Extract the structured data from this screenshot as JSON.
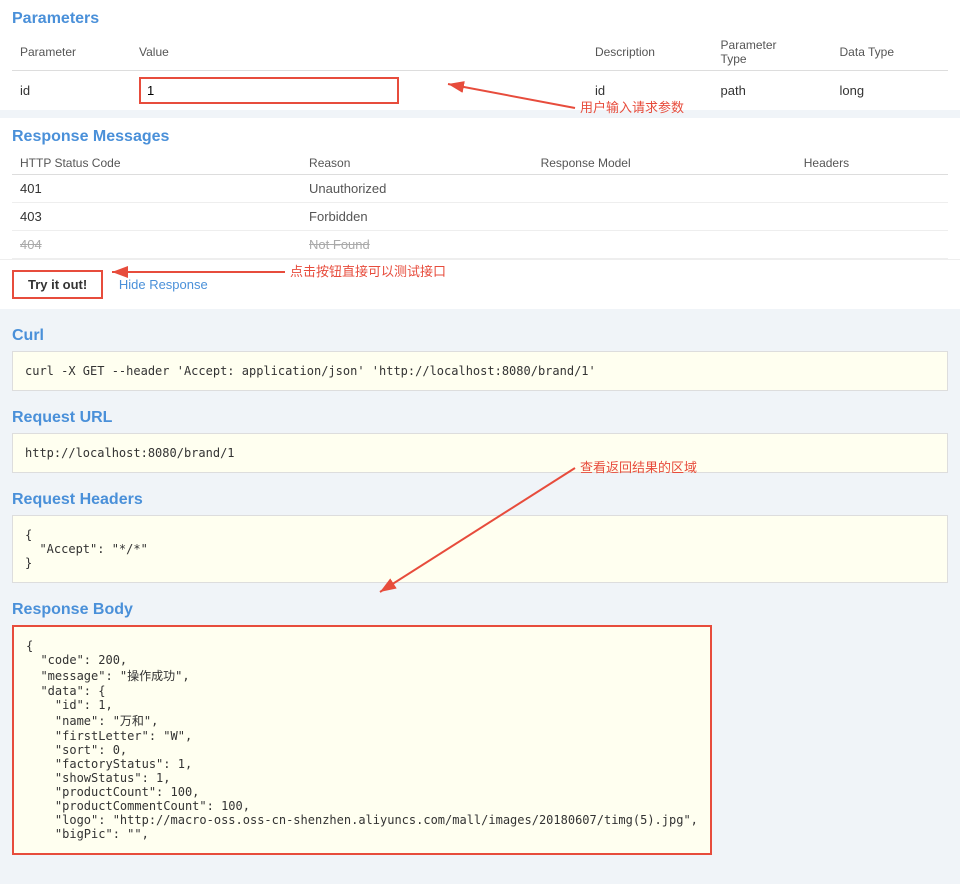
{
  "parameters": {
    "title": "Parameters",
    "columns": {
      "parameter": "Parameter",
      "value": "Value",
      "description": "Description",
      "parameterType": "Parameter Type",
      "dataType": "Data Type"
    },
    "rows": [
      {
        "parameter": "id",
        "value": "1",
        "description": "id",
        "parameterType": "path",
        "dataType": "long"
      }
    ]
  },
  "annotations": {
    "inputHint": "用户输入请求参数",
    "buttonHint": "点击按钮直接可以测试接口",
    "resultHint": "查看返回结果的区域"
  },
  "responseMessages": {
    "title": "Response Messages",
    "columns": {
      "statusCode": "HTTP Status Code",
      "reason": "Reason",
      "responseModel": "Response Model",
      "headers": "Headers"
    },
    "rows": [
      {
        "statusCode": "401",
        "reason": "Unauthorized",
        "responseModel": "",
        "headers": "",
        "strikethrough": false
      },
      {
        "statusCode": "403",
        "reason": "Forbidden",
        "responseModel": "",
        "headers": "",
        "strikethrough": false
      },
      {
        "statusCode": "404",
        "reason": "Not Found",
        "responseModel": "",
        "headers": "",
        "strikethrough": true
      }
    ]
  },
  "buttons": {
    "tryItOut": "Try it out!",
    "hideResponse": "Hide Response"
  },
  "curl": {
    "title": "Curl",
    "value": "curl -X GET --header 'Accept: application/json' 'http://localhost:8080/brand/1'"
  },
  "requestUrl": {
    "title": "Request URL",
    "value": "http://localhost:8080/brand/1"
  },
  "requestHeaders": {
    "title": "Request Headers",
    "value": "{\n  \"Accept\": \"*/*\"\n}"
  },
  "responseBody": {
    "title": "Response Body",
    "value": "{\n  \"code\": 200,\n  \"message\": \"操作成功\",\n  \"data\": {\n    \"id\": 1,\n    \"name\": \"万和\",\n    \"firstLetter\": \"W\",\n    \"sort\": 0,\n    \"factoryStatus\": 1,\n    \"showStatus\": 1,\n    \"productCount\": 100,\n    \"productCommentCount\": 100,\n    \"logo\": \"http://macro-oss.oss-cn-shenzhen.aliyuncs.com/mall/images/20180607/timg(5).jpg\",\n    \"bigPic\": \"\","
  }
}
